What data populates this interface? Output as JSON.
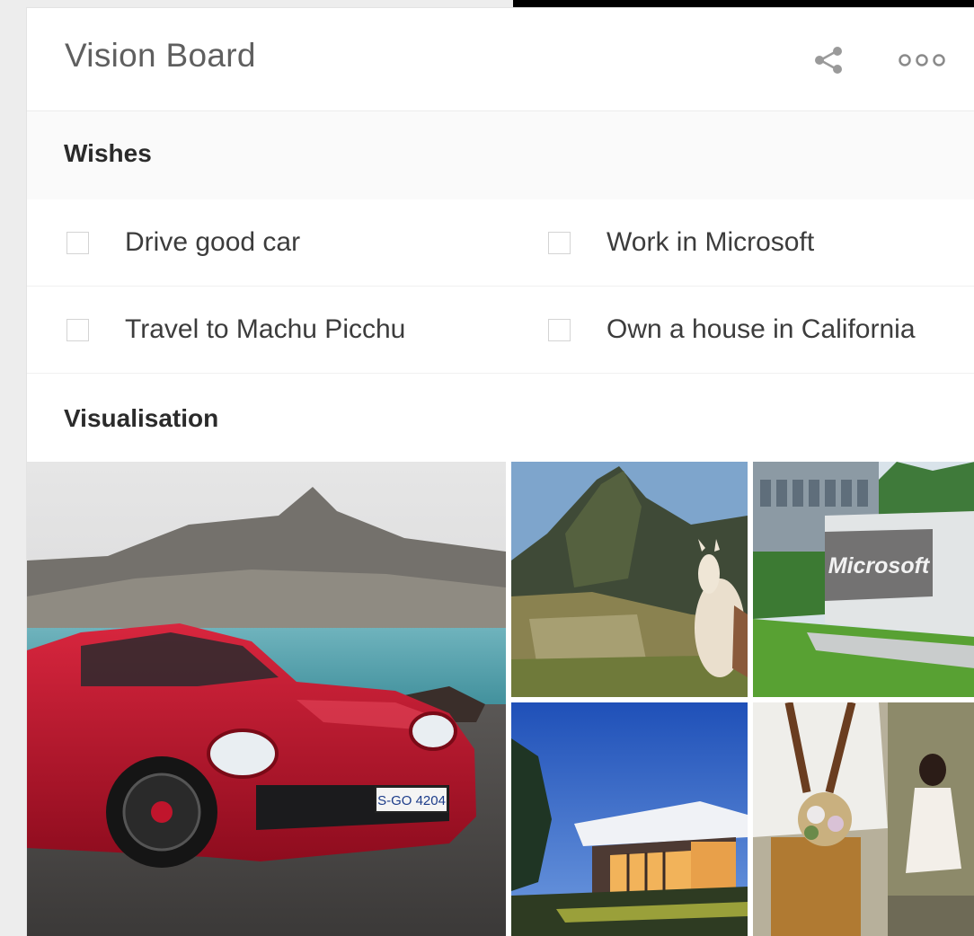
{
  "app": {
    "title": "Vision Board"
  },
  "header": {
    "share_icon": "share-icon",
    "more_icon": "more-icon"
  },
  "sections": {
    "wishes": {
      "label": "Wishes",
      "items": [
        {
          "label": "Drive good car",
          "checked": false
        },
        {
          "label": "Work in Microsoft",
          "checked": false
        },
        {
          "label": "Travel to Machu Picchu",
          "checked": false
        },
        {
          "label": "Own a house in California",
          "checked": false
        }
      ]
    },
    "visualisation": {
      "label": "Visualisation",
      "images": [
        {
          "name": "red sports car by the sea",
          "plate_text": "S-GO 4204"
        },
        {
          "name": "Machu Picchu with llama"
        },
        {
          "name": "Microsoft campus sign",
          "sign_text": "Microsoft"
        },
        {
          "name": "modern house at dusk"
        },
        {
          "name": "couple with flowers"
        }
      ]
    }
  },
  "colors": {
    "title_text": "#5f5f5f",
    "section_bg": "#fafafa",
    "checkbox_border": "#d4d4d4",
    "car_red": "#b3122a"
  }
}
